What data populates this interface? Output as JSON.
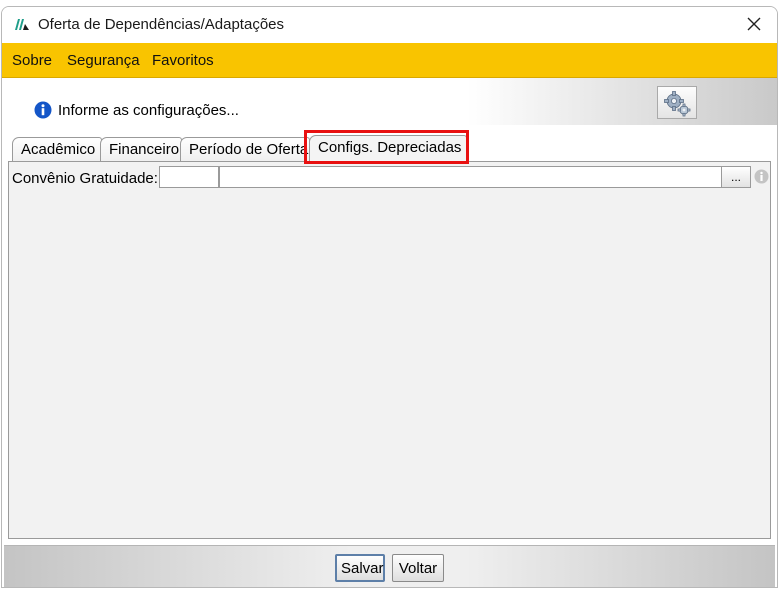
{
  "window": {
    "title": "Oferta de Dependências/Adaptações"
  },
  "menu": {
    "items": [
      "Sobre",
      "Segurança",
      "Favoritos"
    ]
  },
  "header": {
    "info_text": "Informe as configurações..."
  },
  "tabs": {
    "items": [
      "Acadêmico",
      "Financeiro",
      "Período de Oferta",
      "Configs. Depreciadas"
    ],
    "active": "Configs. Depreciadas"
  },
  "form": {
    "convenio_label": "Convênio Gratuidade:",
    "convenio_code": "",
    "convenio_desc": "",
    "lookup_button": "..."
  },
  "footer": {
    "save_label": "Salvar",
    "back_label": "Voltar"
  },
  "colors": {
    "menubar": "#f9c400",
    "highlight": "#e81010",
    "logo": "#1f9e8a"
  }
}
